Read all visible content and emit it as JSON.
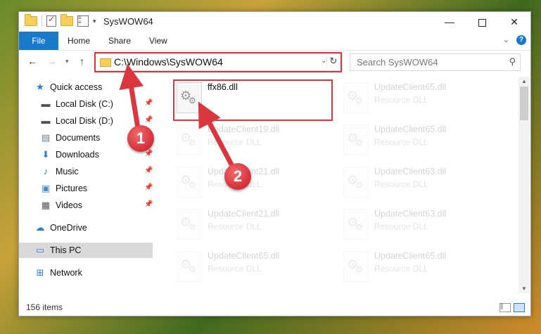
{
  "window": {
    "title": "SysWOW64"
  },
  "ribbon": {
    "tabs": [
      "File",
      "Home",
      "Share",
      "View"
    ]
  },
  "address": {
    "path": "C:\\Windows\\SysWOW64"
  },
  "search": {
    "placeholder": "Search SysWOW64"
  },
  "nav": {
    "items": [
      {
        "label": "Quick access",
        "icon": "star-icon"
      },
      {
        "label": "Local Disk (C:)",
        "icon": "drive-icon",
        "pinned": true
      },
      {
        "label": "Local Disk (D:)",
        "icon": "drive-icon",
        "pinned": true
      },
      {
        "label": "Documents",
        "icon": "document-icon",
        "pinned": true
      },
      {
        "label": "Downloads",
        "icon": "download-icon",
        "pinned": true
      },
      {
        "label": "Music",
        "icon": "music-icon",
        "pinned": true
      },
      {
        "label": "Pictures",
        "icon": "picture-icon",
        "pinned": true
      },
      {
        "label": "Videos",
        "icon": "video-icon",
        "pinned": true
      },
      {
        "label": "OneDrive",
        "icon": "cloud-icon"
      },
      {
        "label": "This PC",
        "icon": "computer-icon",
        "selected": true
      },
      {
        "label": "Network",
        "icon": "network-icon"
      }
    ]
  },
  "files": [
    {
      "name": "ffx86.dll",
      "type": ""
    },
    {
      "name": "UpdateClient65.dll",
      "type": "Resource DLL"
    },
    {
      "name": "UpdateClient19.dll",
      "type": "Resource DLL"
    },
    {
      "name": "UpdateClient65.dll",
      "type": "Resource DLL"
    },
    {
      "name": "UpdateClient21.dll",
      "type": "Resource DLL"
    },
    {
      "name": "UpdateClient63.dll",
      "type": "Resource DLL"
    },
    {
      "name": "UpdateClient21.dll",
      "type": "Resource DLL"
    },
    {
      "name": "UpdateClient63.dll",
      "type": "Resource DLL"
    },
    {
      "name": "UpdateClient65.dll",
      "type": "Resource DLL"
    },
    {
      "name": "UpdateClient65.dll",
      "type": "Resource DLL"
    }
  ],
  "status": {
    "count": "156 items"
  },
  "annotations": {
    "step1": "1",
    "step2": "2",
    "color": "#d9363e"
  }
}
